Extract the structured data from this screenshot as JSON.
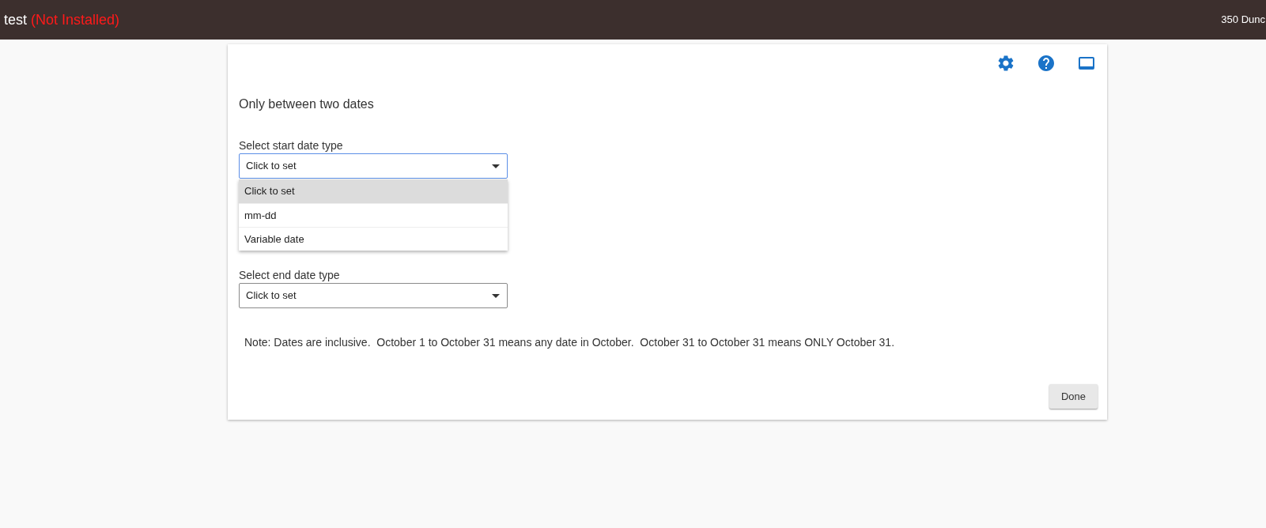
{
  "app_bar": {
    "title": "test",
    "status": "(Not Installed)",
    "location": "350 Dunc"
  },
  "section": {
    "title": "Only between two dates"
  },
  "fields": [
    {
      "label": "Select start date type",
      "value": "Click to set",
      "open": true,
      "options": [
        {
          "label": "Click to set",
          "selected": true
        },
        {
          "label": "mm-dd",
          "selected": false
        },
        {
          "label": "Variable date",
          "selected": false
        }
      ]
    },
    {
      "label": "Select end date type",
      "value": "Click to set",
      "open": false
    }
  ],
  "note": "Note: Dates are inclusive.  October 1 to October 31 means any date in October.  October 31 to October 31 means ONLY October 31.",
  "buttons": [
    {
      "label": "Done"
    }
  ]
}
